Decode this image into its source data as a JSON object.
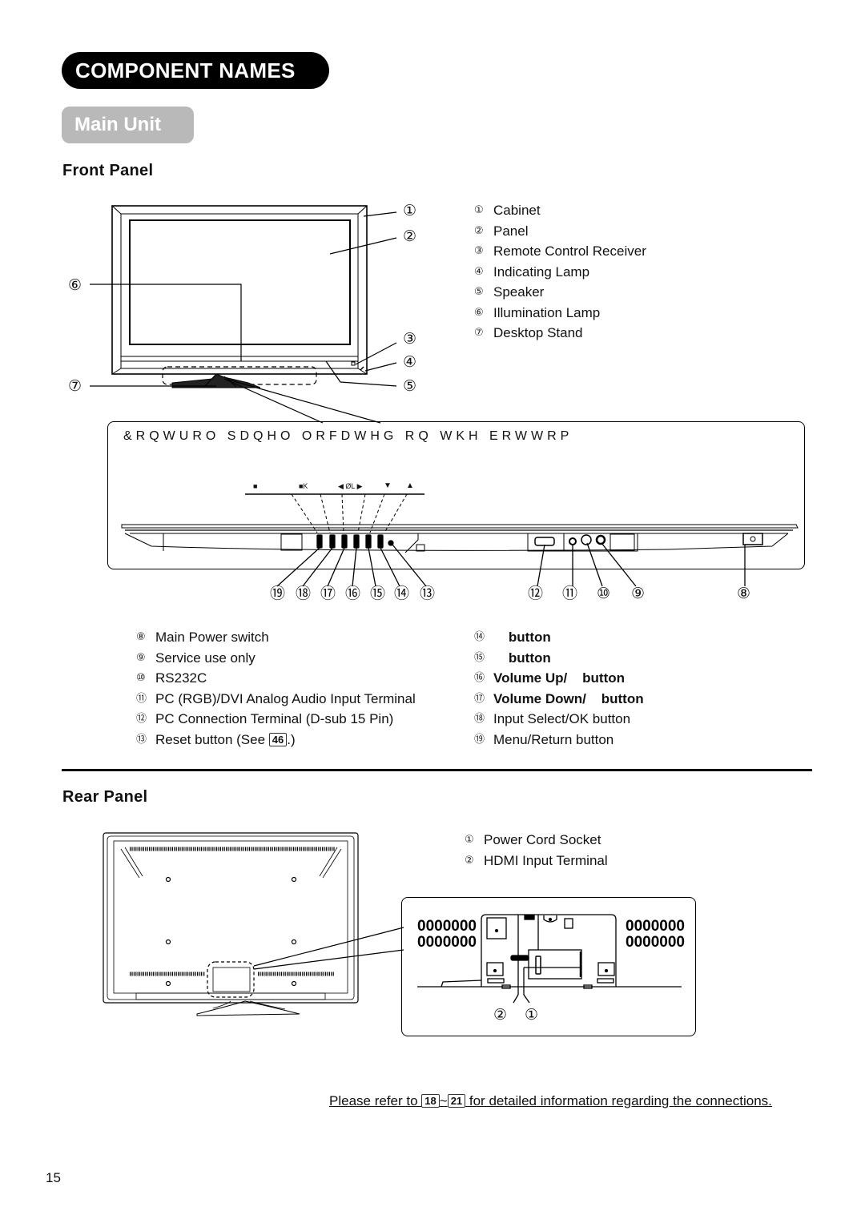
{
  "header": {
    "title": "COMPONENT NAMES",
    "subtitle": "Main Unit"
  },
  "front_panel": {
    "heading": "Front Panel",
    "callouts": [
      "①",
      "②",
      "③",
      "④",
      "⑤",
      "⑥",
      "⑦"
    ],
    "legend": [
      {
        "num": "①",
        "label": "Cabinet"
      },
      {
        "num": "②",
        "label": "Panel"
      },
      {
        "num": "③",
        "label": "Remote Control Receiver"
      },
      {
        "num": "④",
        "label": "Indicating Lamp"
      },
      {
        "num": "⑤",
        "label": "Speaker"
      },
      {
        "num": "⑥",
        "label": "Illumination Lamp"
      },
      {
        "num": "⑦",
        "label": "Desktop Stand"
      }
    ],
    "control_panel_caption": "&RQWURO SDQHO  ORFDWHG RQ WKH ERWWRP",
    "button_glyphs": [
      "■",
      "■K",
      "◀ ØL ▶",
      "▼",
      "▲"
    ],
    "bottom_callouts_left": [
      "⑲",
      "⑱",
      "⑰",
      "⑯",
      "⑮",
      "⑭",
      "⑬"
    ],
    "bottom_callouts_right": [
      "⑫",
      "⑪",
      "⑩",
      "⑨",
      "⑧"
    ],
    "legend_left": [
      {
        "num": "⑧",
        "label": "Main Power switch"
      },
      {
        "num": "⑨",
        "label": "Service use only"
      },
      {
        "num": "⑩",
        "label": "RS232C"
      },
      {
        "num": "⑪",
        "label": "PC (RGB)/DVI Analog Audio Input Terminal"
      },
      {
        "num": "⑫",
        "label": "PC Connection Terminal (D-sub 15 Pin)"
      },
      {
        "num": "⑬",
        "label": "Reset button (See ",
        "page_ref": "46",
        "suffix": ".)"
      }
    ],
    "legend_right": [
      {
        "num": "⑭",
        "label": "    button",
        "bold": true
      },
      {
        "num": "⑮",
        "label": "    button",
        "bold": true
      },
      {
        "num": "⑯",
        "label": "Volume Up/    button",
        "bold": true
      },
      {
        "num": "⑰",
        "label": "Volume Down/    button",
        "bold": true
      },
      {
        "num": "⑱",
        "label": "Input Select/OK button",
        "bold": false
      },
      {
        "num": "⑲",
        "label": "Menu/Return button",
        "bold": false
      }
    ]
  },
  "rear_panel": {
    "heading": "Rear Panel",
    "legend": [
      {
        "num": "①",
        "label": "Power Cord Socket"
      },
      {
        "num": "②",
        "label": "HDMI Input Terminal"
      }
    ],
    "detail_callouts": [
      "②",
      "①"
    ]
  },
  "footer": {
    "note_prefix": "Please refer to ",
    "page_ref_start": "18",
    "range_sep": "~",
    "page_ref_end": "21",
    "note_suffix": " for detailed information regarding the connections.",
    "page_number": "15"
  }
}
